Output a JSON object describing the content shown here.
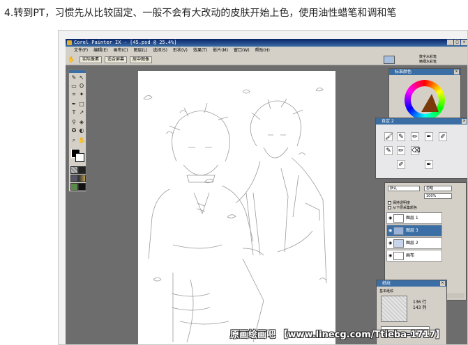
{
  "caption": "4.转到PT，习惯先从比较固定、一般不会有大改动的皮肤开始上色，使用油性蜡笔和调和笔",
  "window": {
    "title": "Corel Painter IX - [45.psd @ 25.4%]",
    "controls": [
      "_",
      "□",
      "×"
    ]
  },
  "menu": [
    "文件(F)",
    "编辑(E)",
    "画布(C)",
    "图层(L)",
    "选择(S)",
    "形状(V)",
    "效果(T)",
    "影片(M)",
    "窗口(W)",
    "帮助(H)"
  ],
  "property_bar": {
    "buttons": [
      "实际像素",
      "适合屏幕",
      "居中图像"
    ]
  },
  "brush_info": {
    "line1": "数字水彩笔",
    "line2": "精细水彩笔"
  },
  "panels": {
    "color_title": "标准颜色",
    "brush_title": "自定 2",
    "layers": {
      "composite": "默认",
      "blend": "忽略",
      "opacity": "100%",
      "opt_preserve": "保持透明度",
      "opt_pick": "从下层采集颜色",
      "rows": [
        {
          "name": "图层 1",
          "selected": false
        },
        {
          "name": "图层 3",
          "selected": true
        },
        {
          "name": "图层 2",
          "selected": false
        },
        {
          "name": "画布",
          "selected": false
        }
      ],
      "footer": "通道"
    },
    "paper": {
      "title": "纸纹",
      "name": "基本纸纹",
      "rows": "136 行",
      "cols": "143 列"
    }
  },
  "watermark": "原画绘画吧 【www.linecg.com/Ttieba-1717】",
  "colors": {
    "titlebar": "#0a246a",
    "workspace": "#6d6d6d",
    "panel": "#d4d0c8",
    "selected_layer": "#3a6ea5"
  }
}
